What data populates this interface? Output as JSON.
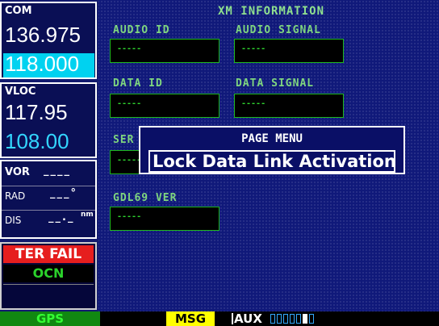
{
  "com": {
    "label": "COM",
    "active": "136.975",
    "standby": "118.000"
  },
  "vloc": {
    "label": "VLOC",
    "active": "117.95",
    "standby": "108.00"
  },
  "nav": {
    "vor_label": "VOR",
    "vor_value": "____",
    "rad_label": "RAD",
    "rad_value": "___°",
    "dis_label": "DIS",
    "dis_value": "__._",
    "dis_unit": "nm"
  },
  "annunciator": {
    "ter_fail": "TER FAIL",
    "ocn": "OCN"
  },
  "page": {
    "title": "XM INFORMATION",
    "fields": [
      {
        "label": "AUDIO ID",
        "value": "-----"
      },
      {
        "label": "AUDIO SIGNAL",
        "value": "-----"
      },
      {
        "label": "DATA ID",
        "value": "-----"
      },
      {
        "label": "DATA SIGNAL",
        "value": "-----"
      },
      {
        "label": "SER",
        "value": "-----"
      },
      {
        "label": "GDL69 VER",
        "value": "-----"
      }
    ]
  },
  "popup": {
    "title": "PAGE MENU",
    "item": "Lock Data Link Activation?"
  },
  "bottom": {
    "gps": "GPS",
    "msg": "MSG",
    "aux": "AUX"
  },
  "colors": {
    "background": "#10197a",
    "field_text": "#7fd67f",
    "ter_fail": "#e61e1e",
    "msg": "#ffff00",
    "standby": "#00d2f0"
  }
}
